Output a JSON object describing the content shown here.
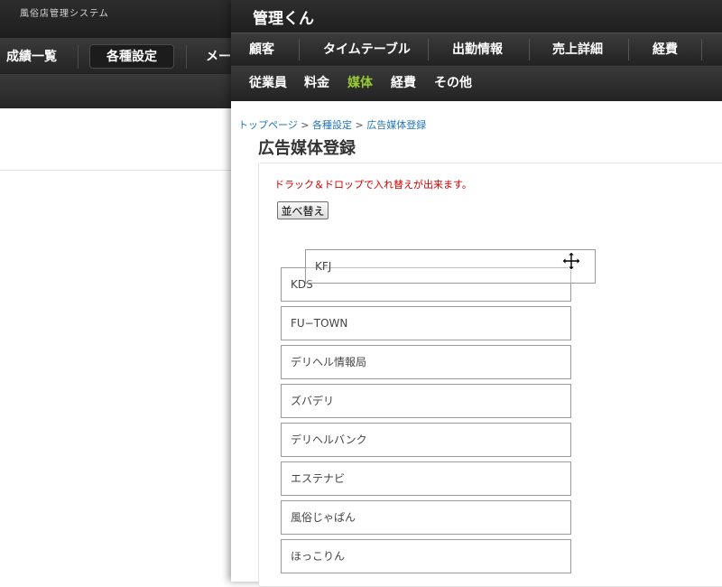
{
  "background_window": {
    "app_title": "風俗店管理システム",
    "nav": [
      "成績一覧",
      "各種設定",
      "メール"
    ]
  },
  "window": {
    "app_title": "管理くん",
    "nav": [
      "顧客",
      "タイムテーブル",
      "出勤情報",
      "売上詳細",
      "経費"
    ],
    "subnav": [
      "従業員",
      "料金",
      "媒体",
      "経費",
      "その他"
    ],
    "active_subnav": "媒体"
  },
  "breadcrumb": [
    "トップページ",
    "各種設定",
    "広告媒体登録"
  ],
  "page_title": "広告媒体登録",
  "instruction": "ドラック＆ドロップで入れ替えが出来ます。",
  "sort_button": "並べ替え",
  "dragging_item": "KFJ",
  "media_items": [
    "KDS",
    "FU−TOWN",
    "デリヘル情報局",
    "ズバデリ",
    "デリヘルバンク",
    "エステナビ",
    "風俗じゃぱん",
    "ほっこりん"
  ],
  "colors": {
    "active_menu": "#99cc33",
    "instruction": "#cc0000",
    "link": "#2277bb"
  },
  "icons": {
    "drag_cursor": "move-arrows"
  }
}
